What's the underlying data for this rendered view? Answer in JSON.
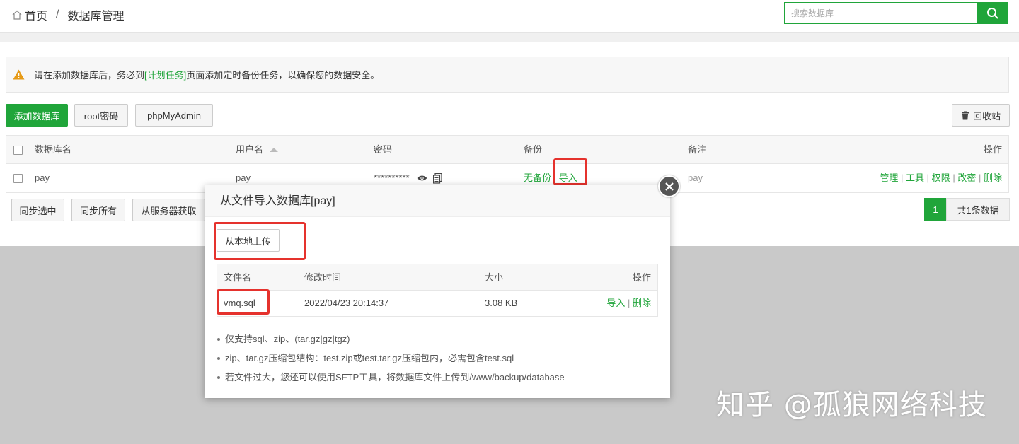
{
  "breadcrumb": {
    "home": "首页",
    "separator": "/",
    "current": "数据库管理"
  },
  "search": {
    "placeholder": "搜索数据库",
    "icon": "search-icon"
  },
  "alert": {
    "icon": "warning-icon",
    "before": "请在添加数据库后，务必到",
    "link": "[计划任务]",
    "after": "页面添加定时备份任务，以确保您的数据安全。"
  },
  "toolbar": {
    "add_db": "添加数据库",
    "root_pwd": "root密码",
    "phpmyadmin": "phpMyAdmin",
    "recycle": "回收站"
  },
  "table": {
    "headers": {
      "name": "数据库名",
      "user": "用户名",
      "password": "密码",
      "backup": "备份",
      "remark": "备注",
      "actions": "操作"
    },
    "rows": [
      {
        "name": "pay",
        "user": "pay",
        "password": "**********",
        "backup_status": "无备份",
        "backup_sep": "|",
        "import": "导入",
        "remark": "pay",
        "actions": [
          "管理",
          "工具",
          "权限",
          "改密",
          "删除"
        ]
      }
    ]
  },
  "bottom": {
    "sync_selected": "同步选中",
    "sync_all": "同步所有",
    "fetch_server": "从服务器获取",
    "page": "1",
    "total": "共1条数据"
  },
  "modal": {
    "title": "从文件导入数据库[pay]",
    "upload": "从本地上传",
    "headers": {
      "filename": "文件名",
      "mtime": "修改时间",
      "size": "大小",
      "actions": "操作"
    },
    "files": [
      {
        "filename": "vmq.sql",
        "mtime": "2022/04/23 20:14:37",
        "size": "3.08 KB",
        "import": "导入",
        "sep": "|",
        "delete": "删除"
      }
    ],
    "notes": [
      "仅支持sql、zip、(tar.gz|gz|tgz)",
      "zip、tar.gz压缩包结构：test.zip或test.tar.gz压缩包内，必需包含test.sql",
      "若文件过大，您还可以使用SFTP工具，将数据库文件上传到/www/backup/database"
    ]
  },
  "watermark": "知乎 @孤狼网络科技",
  "colors": {
    "accent": "#20a53a",
    "highlight": "#e5322d"
  }
}
